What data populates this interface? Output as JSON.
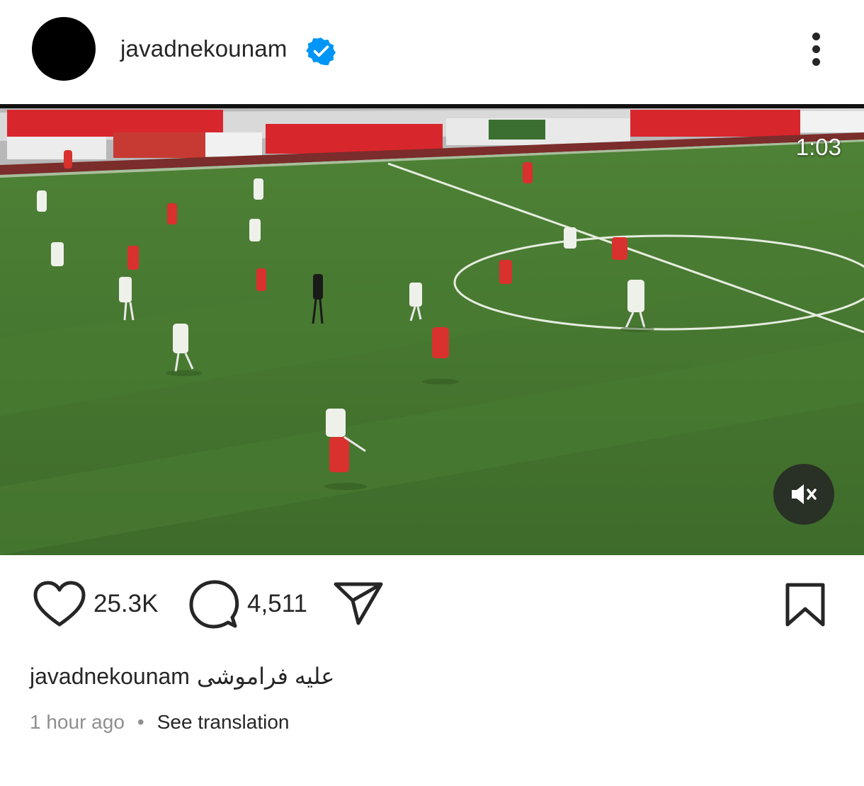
{
  "post": {
    "username": "javadnekounam",
    "video_time": "1:03",
    "likes": "25.3K",
    "comments": "4,511",
    "caption_user": "javadnekounam",
    "caption_text": "علیه فراموشی",
    "posted_ago": "1 hour ago",
    "separator": "•",
    "see_translation": "See translation"
  },
  "icons": {
    "verified": "verified-badge-icon",
    "more": "more-options-icon",
    "mute": "speaker-muted-icon",
    "like": "heart-icon",
    "comment": "comment-bubble-icon",
    "share": "paper-plane-icon",
    "save": "bookmark-icon"
  },
  "colors": {
    "verified_blue": "#0095f6",
    "text": "#262626",
    "secondary_text": "#8e8e8e",
    "pitch_green": "#4a7a33"
  }
}
